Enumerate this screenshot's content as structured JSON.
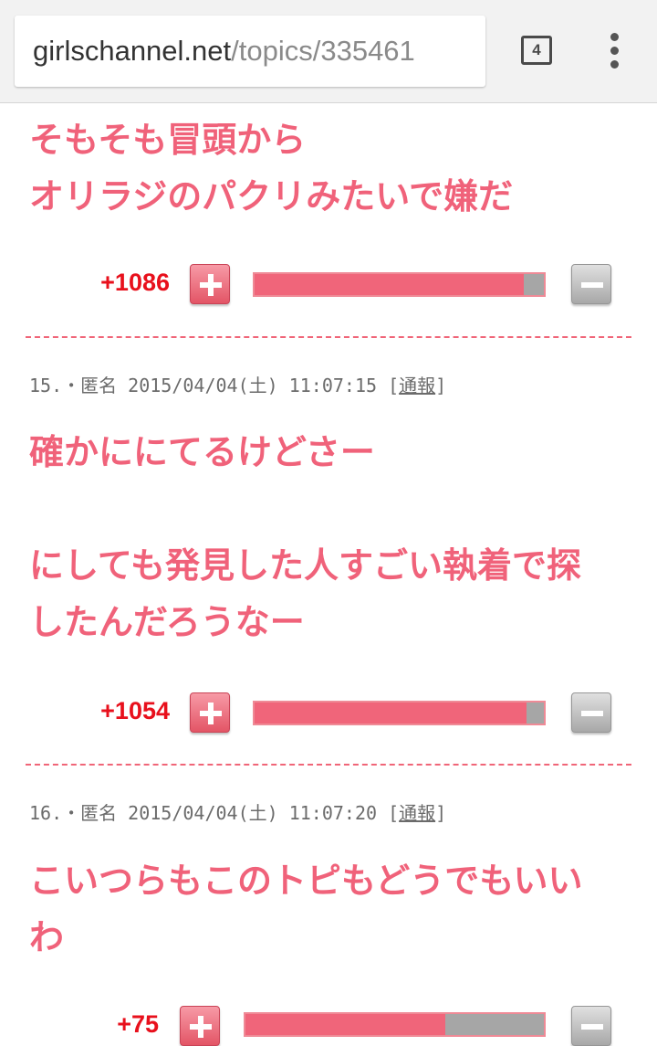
{
  "browser": {
    "url_host": "girlschannel.net",
    "url_path": "/topics/335461",
    "tab_count": "4",
    "icons": {
      "tabs": "tab-switcher-icon",
      "menu": "overflow-menu-icon"
    }
  },
  "comments": [
    {
      "text_lines": [
        "そもそも冒頭から",
        "オリラジのパクリみたいで嫌だ"
      ],
      "score": "+1086",
      "plus_ratio": 0.93
    },
    {
      "meta": "15.・匿名 2015/04/04(土) 11:07:15 [",
      "report": "通報",
      "meta_end": "]",
      "text_lines": [
        "確かににてるけどさー",
        "",
        "にしても発見した人すごい執着で探",
        "したんだろうなー"
      ],
      "score": "+1054",
      "plus_ratio": 0.94
    },
    {
      "meta": "16.・匿名 2015/04/04(土) 11:07:20 [",
      "report": "通報",
      "meta_end": "]",
      "text_lines": [
        "こいつらもこのトピもどうでもいい",
        "わ"
      ],
      "score": "+75",
      "plus_ratio": 0.67
    }
  ],
  "colors": {
    "accent_pink": "#f0627a",
    "score_red": "#e8101c",
    "bar_gray": "#a6a6a6"
  }
}
